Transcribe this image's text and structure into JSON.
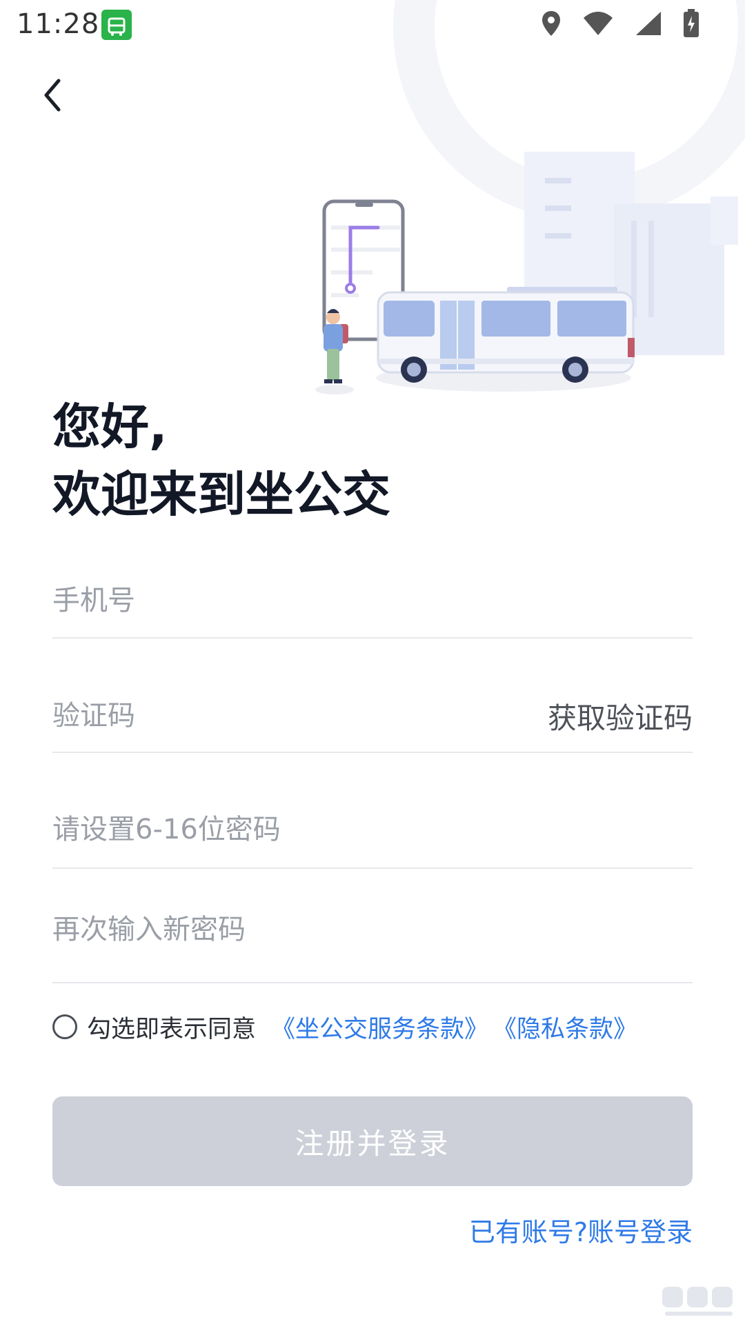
{
  "status_bar": {
    "time": "11:28"
  },
  "icons": {
    "back": "chevron-left-icon",
    "location": "location-icon",
    "wifi": "wifi-icon",
    "signal": "signal-icon",
    "battery": "battery-icon"
  },
  "greeting": {
    "line1": "您好,",
    "line2": "欢迎来到坐公交"
  },
  "form": {
    "phone_placeholder": "手机号",
    "code_placeholder": "验证码",
    "get_code_label": "获取验证码",
    "password_placeholder": "请设置6-16位密码",
    "confirm_placeholder": "再次输入新密码"
  },
  "agreement": {
    "text": "勾选即表示同意",
    "terms_link": "《坐公交服务条款》",
    "privacy_link": "《隐私条款》"
  },
  "submit_label": "注册并登录",
  "login_link": "已有账号?账号登录",
  "colors": {
    "accent": "#2e7ae8",
    "button_disabled": "#cdd0d8",
    "app_badge": "#29b34a"
  }
}
